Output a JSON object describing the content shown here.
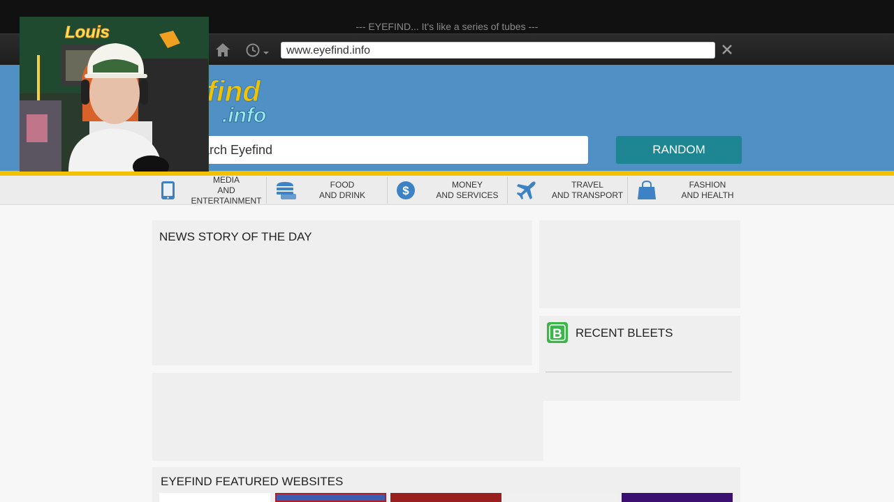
{
  "browser": {
    "title_bar_text": "--- EYEFIND... It's like a series of tubes ---",
    "address": "www.eyefind.info",
    "icons": [
      "home-icon",
      "history-icon",
      "close-icon"
    ]
  },
  "header": {
    "logo_text": "find",
    "logo_subtext": ".info",
    "search_text": "arch Eyefind",
    "random_label": "RANDOM"
  },
  "categories": [
    {
      "icon": "tablet-icon",
      "line1": "MEDIA",
      "line2": "AND ENTERTAINMENT"
    },
    {
      "icon": "burger-icon",
      "line1": "FOOD",
      "line2": "AND DRINK"
    },
    {
      "icon": "dollar-icon",
      "line1": "MONEY",
      "line2": "AND SERVICES"
    },
    {
      "icon": "plane-icon",
      "line1": "TRAVEL",
      "line2": "AND TRANSPORT"
    },
    {
      "icon": "shopping-bag-icon",
      "line1": "FASHION",
      "line2": "AND HEALTH"
    }
  ],
  "main": {
    "news_heading": "NEWS STORY OF THE DAY",
    "bleets_heading": "RECENT BLEETS",
    "featured_heading": "EYEFIND FEATURED WEBSITES"
  },
  "webcam_overlay": {
    "sign_text": "Louis"
  },
  "colors": {
    "header_blue": "#5090c4",
    "accent_yellow": "#f2c200",
    "random_teal": "#1e8693",
    "bleeter_green": "#3cb54a"
  }
}
